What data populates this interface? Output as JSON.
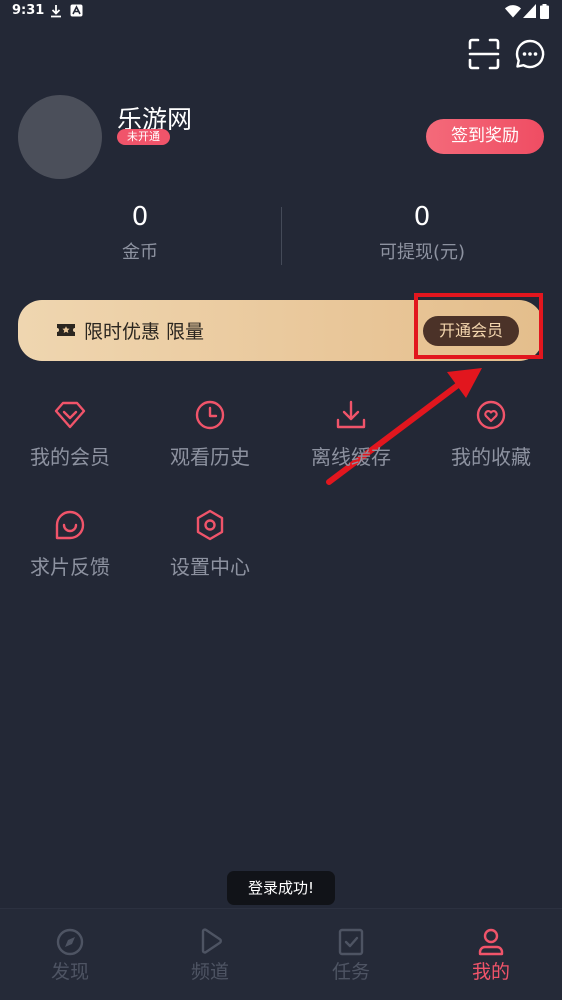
{
  "status_bar": {
    "time": "9:31"
  },
  "profile": {
    "username": "乐游网",
    "member_badge": "未开通",
    "checkin_label": "签到奖励"
  },
  "stats": [
    {
      "value": "0",
      "label": "金币"
    },
    {
      "value": "0",
      "label": "可提现(元)"
    }
  ],
  "vip_banner": {
    "text": "限时优惠 限量",
    "button_label": "开通会员"
  },
  "menu": {
    "items": [
      {
        "label": "我的会员",
        "icon": "diamond-icon"
      },
      {
        "label": "观看历史",
        "icon": "clock-icon"
      },
      {
        "label": "离线缓存",
        "icon": "download-icon"
      },
      {
        "label": "我的收藏",
        "icon": "heart-icon"
      },
      {
        "label": "求片反馈",
        "icon": "chat-smile-icon"
      },
      {
        "label": "设置中心",
        "icon": "settings-icon"
      }
    ]
  },
  "toast": {
    "text": "登录成功!"
  },
  "tabs": [
    {
      "label": "发现",
      "icon": "compass-icon"
    },
    {
      "label": "频道",
      "icon": "play-icon"
    },
    {
      "label": "任务",
      "icon": "task-icon"
    },
    {
      "label": "我的",
      "icon": "user-icon",
      "active": true
    }
  ],
  "colors": {
    "background": "#232836",
    "accent": "#f0546a",
    "vip_gold": "#e9c79a",
    "highlight": "#e2161e"
  }
}
